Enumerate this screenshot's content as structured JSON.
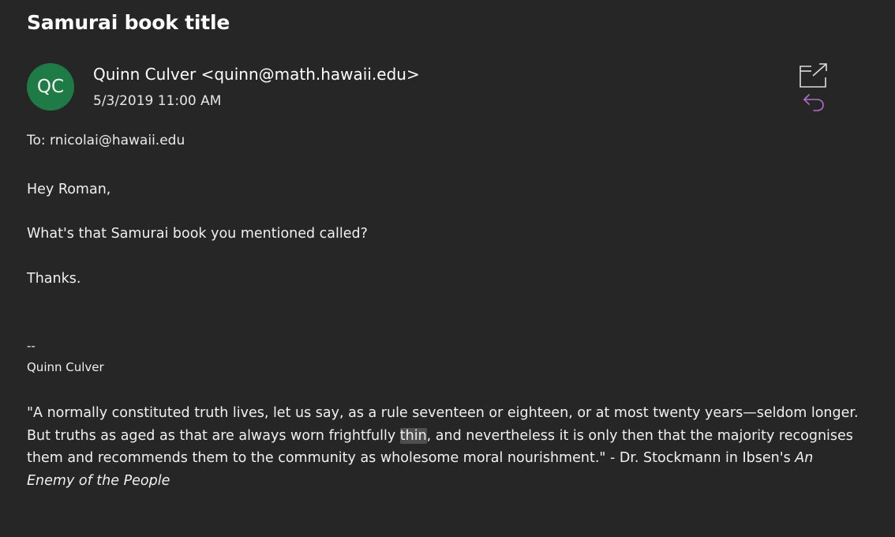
{
  "subject": "Samurai book title",
  "avatar_initials": "QC",
  "avatar_color": "#1e7b45",
  "accent_color": "#b26fcb",
  "sender": "Quinn Culver <quinn@math.hawaii.edu>",
  "date": "5/3/2019 11:00 AM",
  "to": "To: rnicolai@hawaii.edu",
  "body": {
    "greeting": "Hey Roman,",
    "question": "What's that Samurai book you mentioned called?",
    "thanks": "Thanks.",
    "sig_dashes": "--",
    "sig_name": "Quinn Culver",
    "quote_part1": "\"A normally constituted truth lives, let us say, as a rule seventeen or eighteen, or at most twenty years—seldom longer. But truths as aged as that are always worn frightfully ",
    "quote_highlight": "thin",
    "quote_part2": ", and nevertheless it is only then that the majority recognises them and recommends them to the community as wholesome moral nourishment.\" - Dr. Stockmann in Ibsen's ",
    "quote_title": "An Enemy of the People"
  },
  "icons": {
    "popout": "open-in-new-window-icon",
    "reply": "reply-icon"
  }
}
